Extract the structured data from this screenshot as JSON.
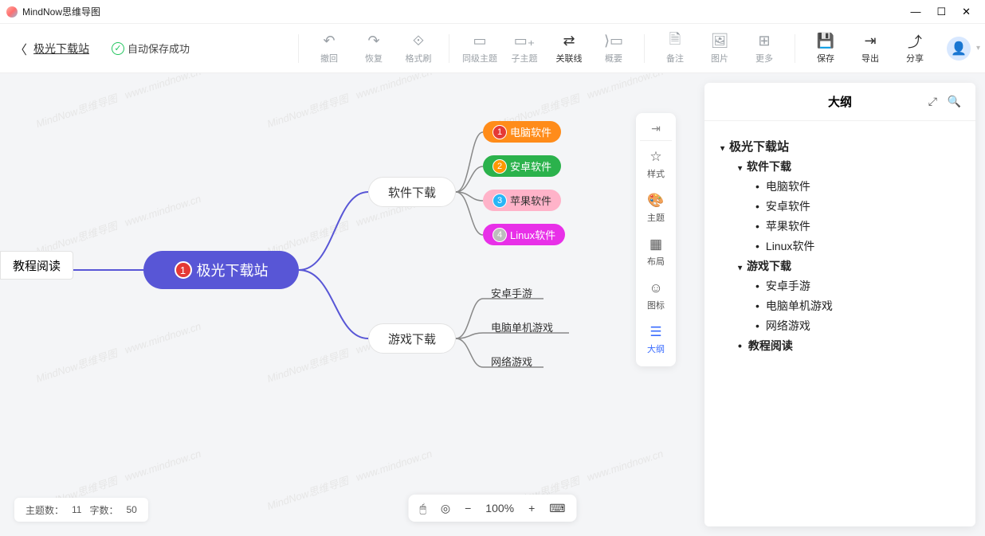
{
  "window": {
    "title": "MindNow思维导图"
  },
  "header": {
    "doc_name": "极光下载站",
    "autosave": "自动保存成功"
  },
  "toolbar": {
    "undo": "撤回",
    "redo": "恢复",
    "format": "格式刷",
    "sibling": "同级主题",
    "child": "子主题",
    "relation": "关联线",
    "summary": "概要",
    "note": "备注",
    "image": "图片",
    "more": "更多",
    "save": "保存",
    "export": "导出",
    "share": "分享"
  },
  "sidetools": {
    "style": "样式",
    "theme": "主题",
    "layout": "布局",
    "icon": "图标",
    "outline": "大纲"
  },
  "mindmap": {
    "root": "极光下载站",
    "left": "教程阅读",
    "software": {
      "label": "软件下载",
      "children": [
        "电脑软件",
        "安卓软件",
        "苹果软件",
        "Linux软件"
      ]
    },
    "games": {
      "label": "游戏下载",
      "children": [
        "安卓手游",
        "电脑单机游戏",
        "网络游戏"
      ]
    }
  },
  "outline": {
    "title": "大纲",
    "root": "极光下载站",
    "software": "软件下载",
    "software_items": [
      "电脑软件",
      "安卓软件",
      "苹果软件",
      "Linux软件"
    ],
    "games": "游戏下载",
    "games_items": [
      "安卓手游",
      "电脑单机游戏",
      "网络游戏"
    ],
    "reading": "教程阅读"
  },
  "status": {
    "topics_label": "主题数：",
    "topics": "11",
    "words_label": "字数：",
    "words": "50",
    "zoom": "100%"
  }
}
